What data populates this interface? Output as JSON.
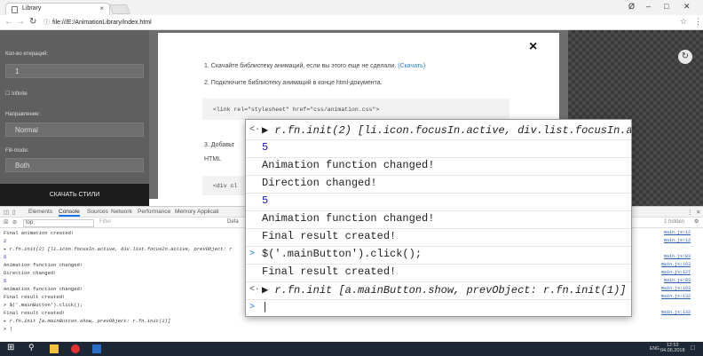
{
  "browser": {
    "tab_title": "Library",
    "tab_close": "×",
    "url": "file:///E:/AnimationLibrary/index.html",
    "window_controls": [
      "Ø",
      "–",
      "□",
      "✕"
    ]
  },
  "left_panel": {
    "label_iterations": "Кол-во итераций:",
    "iterations_value": "1",
    "label_infinite": "☐ Infinite",
    "label_direction": "Направление:",
    "direction_value": "Normal",
    "label_fill_mode": "Fill-mode:",
    "fill_mode_value": "Both",
    "download_button": "СКАЧАТЬ СТИЛИ"
  },
  "modal": {
    "close": "×",
    "step1_text": "1. Скачайте библиотеку анимаций, если вы этого еще не сделали.",
    "step1_link": "(Скачать)",
    "step2_text": "2. Подключите библиотеку анимаций в конце html-документа.",
    "code1": "<link rel=\"stylesheet\" href=\"css/animation.css\">",
    "step3_text": "3. Добавьт",
    "html_label": "HTML",
    "code2": "<div cl"
  },
  "devtools": {
    "tabs": [
      "Elements",
      "Console",
      "Sources",
      "Network",
      "Performance",
      "Memory",
      "Applicati"
    ],
    "active_tab": "Console",
    "context": "top",
    "filter_placeholder": "Filter",
    "default_levels": "Defa",
    "hidden_count": "1 hidden",
    "console_lines": [
      {
        "text": "Final animation created!",
        "cls": "",
        "src": "main.js:12"
      },
      {
        "text": "2",
        "cls": "blue",
        "src": "main.js:12"
      },
      {
        "text": "▸ r.fn.init(2) [li.icon.focusIn.active, div.list.focusIn.active, prevObject: r",
        "cls": "it",
        "src": ""
      },
      {
        "text": "5",
        "cls": "blue",
        "src": "main.js:83"
      },
      {
        "text": "Animation function changed!",
        "cls": "",
        "src": "main.js:163"
      },
      {
        "text": "Direction changed!",
        "cls": "",
        "src": "main.js:127"
      },
      {
        "text": "5",
        "cls": "blue",
        "src": "main.js:83"
      },
      {
        "text": "Animation function changed!",
        "cls": "",
        "src": "main.js:163"
      },
      {
        "text": "Final result created!",
        "cls": "",
        "src": "main.js:132"
      },
      {
        "text": "> $('.mainButton').click();",
        "cls": "",
        "src": ""
      },
      {
        "text": "Final result created!",
        "cls": "",
        "src": "main.js:132"
      },
      {
        "text": "▸ r.fn.init [a.mainButton.show, prevObject: r.fn.init(1)]",
        "cls": "it",
        "src": ""
      },
      {
        "text": "> |",
        "cls": "",
        "src": ""
      }
    ]
  },
  "zoom_console": {
    "lines": [
      {
        "text": "▶ r.fn.init(2) [li.icon.focusIn.active, div.list.focusIn.acti",
        "cls": "obj",
        "prompt": "<·"
      },
      {
        "text": "5",
        "cls": "num",
        "prompt": ""
      },
      {
        "text": "Animation function changed!",
        "cls": "",
        "prompt": ""
      },
      {
        "text": "Direction changed!",
        "cls": "",
        "prompt": ""
      },
      {
        "text": "5",
        "cls": "num",
        "prompt": ""
      },
      {
        "text": "Animation function changed!",
        "cls": "",
        "prompt": ""
      },
      {
        "text": "Final result created!",
        "cls": "",
        "prompt": ""
      },
      {
        "text": "$('.mainButton').click();",
        "cls": "",
        "prompt": ">"
      },
      {
        "text": "Final result created!",
        "cls": "",
        "prompt": ""
      },
      {
        "text": "▶ r.fn.init [a.mainButton.show, prevObject: r.fn.init(1)]",
        "cls": "obj",
        "prompt": "<·"
      },
      {
        "text": "|",
        "cls": "",
        "prompt": ">"
      }
    ]
  },
  "taskbar": {
    "time": "12:52",
    "date": "04.06.2018",
    "lang": "ENG"
  }
}
